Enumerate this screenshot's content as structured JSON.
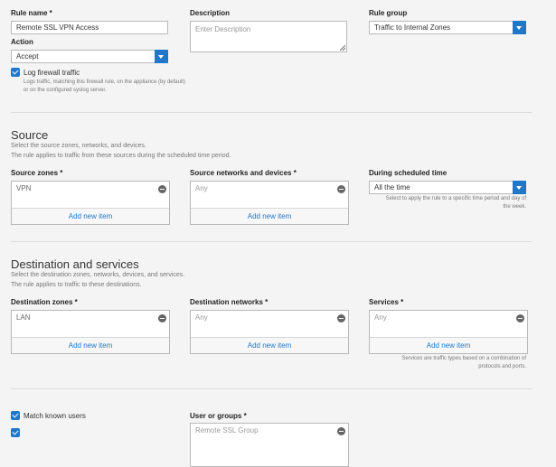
{
  "rule": {
    "name_label": "Rule name *",
    "name_value": "Remote SSL VPN Access",
    "action_label": "Action",
    "action_value": "Accept",
    "log_label": "Log firewall traffic",
    "log_help": "Logs traffic, matching this firewall rule, on the appliance (by default) or on the configured syslog server.",
    "description_label": "Description",
    "description_placeholder": "Enter Description",
    "group_label": "Rule group",
    "group_value": "Traffic to Internal Zones"
  },
  "source": {
    "title": "Source",
    "desc1": "Select the source zones, networks, and devices.",
    "desc2": "The rule applies to traffic from these sources during the scheduled time period.",
    "zones_label": "Source zones *",
    "zones_item": "VPN",
    "networks_label": "Source networks and devices *",
    "networks_item": "Any",
    "schedule_label": "During scheduled time",
    "schedule_value": "All the time",
    "schedule_help": "Select to apply the rule to a specific time period and day of the week.",
    "add_zones": "Add new item",
    "add_networks": "Add new item"
  },
  "destination": {
    "title": "Destination and services",
    "desc1": "Select the destination zones, networks, devices, and services.",
    "desc2": "The rule applies to traffic to these destinations.",
    "zones_label": "Destination zones *",
    "zones_item": "LAN",
    "networks_label": "Destination networks *",
    "networks_item": "Any",
    "services_label": "Services *",
    "services_item": "Any",
    "services_help": "Services are traffic types based on a combination of protocols and ports.",
    "add_zones": "Add new item",
    "add_networks": "Add new item",
    "add_services": "Add new item"
  },
  "users": {
    "match_label": "Match known users",
    "groups_label": "User or groups *",
    "groups_item": "Remote SSL Group"
  },
  "colors": {
    "accent": "#1f77c9",
    "background": "#f4f4f4"
  }
}
